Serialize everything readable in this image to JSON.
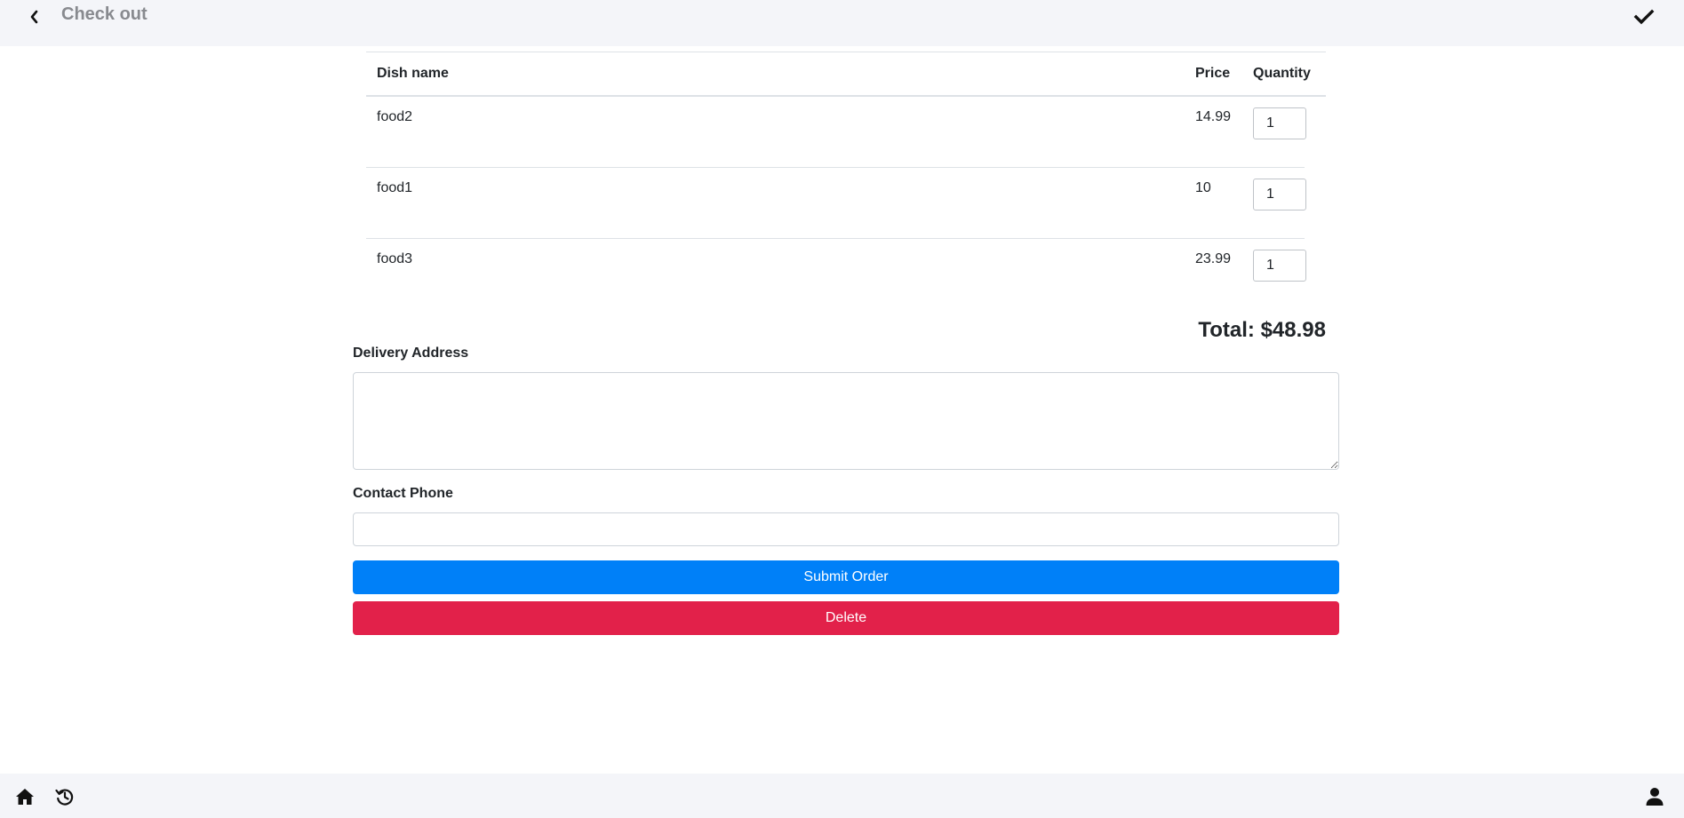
{
  "header": {
    "title": "Check out",
    "back_icon": "chevron-left-icon",
    "confirm_icon": "check-icon"
  },
  "table": {
    "columns": [
      "Dish name",
      "Price",
      "Quantity"
    ],
    "rows": [
      {
        "name": "food2",
        "price": "14.99",
        "quantity": "1"
      },
      {
        "name": "food1",
        "price": "10",
        "quantity": "1"
      },
      {
        "name": "food3",
        "price": "23.99",
        "quantity": "1"
      }
    ]
  },
  "total": "Total: $48.98",
  "form": {
    "address_label": "Delivery Address",
    "address_value": "",
    "phone_label": "Contact Phone",
    "phone_value": ""
  },
  "buttons": {
    "submit": "Submit Order",
    "delete": "Delete"
  },
  "colors": {
    "submit": "#0080f8",
    "delete": "#e2214a",
    "bar_background": "#f4f5f9"
  },
  "footer": {
    "icons": [
      "home-icon",
      "history-icon",
      "user-icon"
    ]
  }
}
